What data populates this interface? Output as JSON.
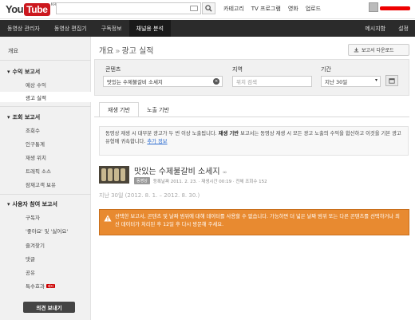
{
  "header": {
    "logo_you": "You",
    "logo_tube": "Tube",
    "logo_region": "KR",
    "nav": [
      "카테고리",
      "TV 프로그램",
      "영화",
      "업로드"
    ]
  },
  "darknav": {
    "left": [
      "동영상 관리자",
      "동영상 편집기",
      "구독정보",
      "채널용 분석"
    ],
    "active_index": 3,
    "right": [
      "메시지함",
      "설정"
    ]
  },
  "sidebar": {
    "overview": "개요",
    "sections": [
      {
        "title": "수익 보고서",
        "items": [
          "예상 수익",
          "광고 실적"
        ]
      },
      {
        "title": "조회 보고서",
        "items": [
          "조회수",
          "인구통계",
          "재생 위치",
          "트래픽 소스",
          "잠재고객 보유"
        ]
      },
      {
        "title": "사용자 참여 보고서",
        "items": [
          "구독자",
          "'좋아요' 및 '싫어요'",
          "즐겨찾기",
          "댓글",
          "공유",
          "특수효과"
        ]
      }
    ],
    "beta_label": "베타",
    "feedback_label": "의견 보내기"
  },
  "main": {
    "breadcrumb_root": "개요",
    "breadcrumb_current": "광고 실적",
    "download_label": "보고서 다운로드",
    "filters": {
      "content_label": "콘텐츠",
      "content_value": "맛있는 수제불갈비 소세지",
      "region_label": "지역",
      "region_placeholder": "위치 검색",
      "period_label": "기간",
      "period_value": "지난 30일"
    },
    "tabs": [
      "재생 기반",
      "노출 기반"
    ],
    "notice": {
      "text1": "동영상 재생 시 대부분 광고가 두 번 이상 노출됩니다.",
      "bold": "재생 기반",
      "text2": " 보고서는 동영상 재생 시 모든 광고 노출의 수익을 합산하고 이것을 기본 광고 유형에 귀속합니다.",
      "link": "추가 정보"
    },
    "video": {
      "title": "맛있는 수제불갈비 소세지",
      "badge": "동영상",
      "meta": "등록날짜 2011. 2. 23. · 재생시간 00:19 · 전체 조회수 152"
    },
    "period_text": "지난 30일 (2012. 8. 1. – 2012. 8. 30.)",
    "warning": "선택한 보고서, 콘텐츠 및 날짜 범위에 대해 데이터를 사용할 수 없습니다. 가능하면 더 넓은 날짜 범위 또는 다른 콘텐츠를 선택하거나 최신 데이터가 처리된 후 12일 후 다시 방문해 주세요."
  },
  "colors": {
    "brand_red": "#cc181e",
    "nav_dark": "#2b2b2b",
    "warning_orange": "#e88a30",
    "link_blue": "#2a6bd1"
  }
}
